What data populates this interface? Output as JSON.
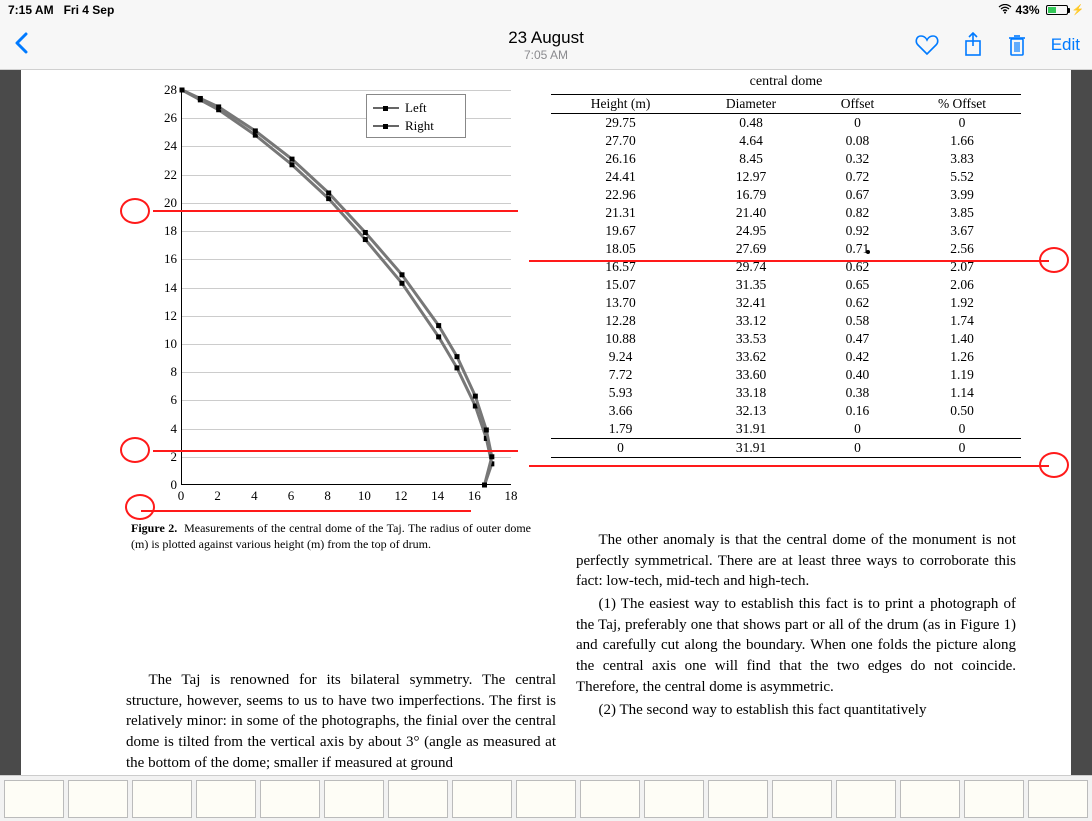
{
  "statusbar": {
    "time": "7:15 AM",
    "date": "Fri 4 Sep",
    "battery_pct": "43%"
  },
  "navbar": {
    "title": "23 August",
    "subtitle": "7:05 AM",
    "edit": "Edit"
  },
  "chart_data": {
    "type": "line",
    "xlabel": "",
    "ylabel": "",
    "xlim": [
      0,
      18
    ],
    "ylim": [
      0,
      28
    ],
    "xticks": [
      0,
      2,
      4,
      6,
      8,
      10,
      12,
      14,
      16,
      18
    ],
    "yticks": [
      0,
      2,
      4,
      6,
      8,
      10,
      12,
      14,
      16,
      18,
      20,
      22,
      24,
      26,
      28
    ],
    "series": [
      {
        "name": "Left",
        "points": [
          [
            0,
            28
          ],
          [
            1,
            27.3
          ],
          [
            2,
            26.6
          ],
          [
            4,
            24.8
          ],
          [
            6,
            22.7
          ],
          [
            8,
            20.3
          ],
          [
            10,
            17.4
          ],
          [
            12,
            14.3
          ],
          [
            14,
            10.5
          ],
          [
            15,
            8.3
          ],
          [
            16,
            5.6
          ],
          [
            16.6,
            3.3
          ],
          [
            16.9,
            1.5
          ],
          [
            16.5,
            0
          ]
        ]
      },
      {
        "name": "Right",
        "points": [
          [
            0,
            28
          ],
          [
            1,
            27.4
          ],
          [
            2,
            26.8
          ],
          [
            4,
            25.1
          ],
          [
            6,
            23.1
          ],
          [
            8,
            20.7
          ],
          [
            10,
            17.9
          ],
          [
            12,
            14.9
          ],
          [
            14,
            11.3
          ],
          [
            15,
            9.1
          ],
          [
            16,
            6.3
          ],
          [
            16.6,
            3.9
          ],
          [
            16.9,
            2.0
          ],
          [
            16.5,
            0
          ]
        ]
      }
    ],
    "legend": [
      "Left",
      "Right"
    ]
  },
  "figure_caption": {
    "label": "Figure 2.",
    "text": "Measurements of the central dome of the Taj. The radius of outer dome (m) is plotted against various height (m) from the top of drum."
  },
  "table": {
    "title": "central dome",
    "headers": [
      "Height (m)",
      "Diameter",
      "Offset",
      "% Offset"
    ],
    "rows": [
      [
        "29.75",
        "0.48",
        "0",
        "0"
      ],
      [
        "27.70",
        "4.64",
        "0.08",
        "1.66"
      ],
      [
        "26.16",
        "8.45",
        "0.32",
        "3.83"
      ],
      [
        "24.41",
        "12.97",
        "0.72",
        "5.52"
      ],
      [
        "22.96",
        "16.79",
        "0.67",
        "3.99"
      ],
      [
        "21.31",
        "21.40",
        "0.82",
        "3.85"
      ],
      [
        "19.67",
        "24.95",
        "0.92",
        "3.67"
      ],
      [
        "18.05",
        "27.69",
        "0.71",
        "2.56"
      ],
      [
        "16.57",
        "29.74",
        "0.62",
        "2.07"
      ],
      [
        "15.07",
        "31.35",
        "0.65",
        "2.06"
      ],
      [
        "13.70",
        "32.41",
        "0.62",
        "1.92"
      ],
      [
        "12.28",
        "33.12",
        "0.58",
        "1.74"
      ],
      [
        "10.88",
        "33.53",
        "0.47",
        "1.40"
      ],
      [
        "9.24",
        "33.62",
        "0.42",
        "1.26"
      ],
      [
        "7.72",
        "33.60",
        "0.40",
        "1.19"
      ],
      [
        "5.93",
        "33.18",
        "0.38",
        "1.14"
      ],
      [
        "3.66",
        "32.13",
        "0.16",
        "0.50"
      ],
      [
        "1.79",
        "31.91",
        "0",
        "0"
      ],
      [
        "0",
        "31.91",
        "0",
        "0"
      ]
    ]
  },
  "body": {
    "p1": "The Taj is renowned for its bilateral symmetry. The central structure, however, seems to us to have two imperfections. The first is relatively minor: in some of the photographs, the finial over the central dome is tilted from the vertical axis by about 3° (angle as measured at the bottom of the dome; smaller if measured at ground",
    "p2": "The other anomaly is that the central dome of the monument is not perfectly symmetrical. There are at least three ways to corroborate this fact: low-tech, mid-tech and high-tech.",
    "p3": "(1) The easiest way to establish this fact is to print a photograph of the Taj, preferably one that shows part or all of the drum (as in Figure 1) and carefully cut along the boundary. When one folds the picture along the cen­tral axis one will find that the two edges do not coincide. Therefore, the central dome is asymmetric.",
    "p4": "(2) The second way to establish this fact quantitatively"
  }
}
